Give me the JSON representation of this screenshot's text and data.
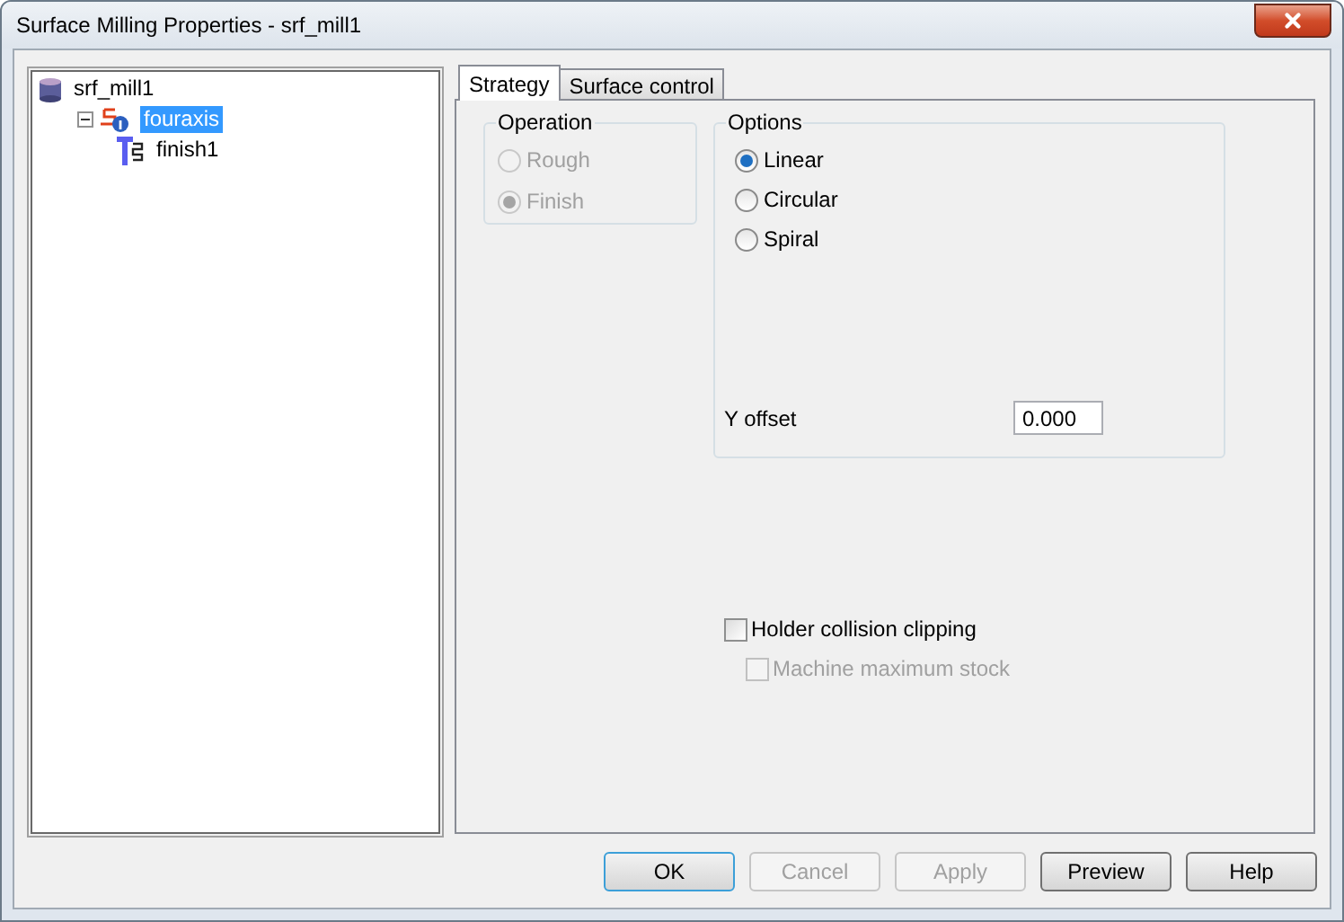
{
  "window": {
    "title": "Surface Milling Properties - srf_mill1"
  },
  "tree": [
    {
      "label": "srf_mill1",
      "kind": "database",
      "selected": false,
      "children": [
        {
          "label": "fouraxis",
          "kind": "operation",
          "selected": true,
          "expanded": true,
          "children": [
            {
              "label": "finish1",
              "kind": "tool",
              "selected": false
            }
          ]
        }
      ]
    }
  ],
  "tabs": [
    {
      "label": "Strategy",
      "selected": true
    },
    {
      "label": "Surface control",
      "selected": false
    }
  ],
  "operation": {
    "title": "Operation",
    "disabled": true,
    "options": [
      {
        "label": "Rough",
        "selected": false
      },
      {
        "label": "Finish",
        "selected": true
      }
    ]
  },
  "options": {
    "title": "Options",
    "choices": [
      {
        "label": "Linear",
        "selected": true
      },
      {
        "label": "Circular",
        "selected": false
      },
      {
        "label": "Spiral",
        "selected": false
      }
    ],
    "y_offset": {
      "label": "Y offset",
      "value": "0.000"
    }
  },
  "checkboxes": [
    {
      "label": "Holder collision clipping",
      "checked": false,
      "disabled": false
    },
    {
      "label": "Machine maximum stock",
      "checked": false,
      "disabled": true
    }
  ],
  "buttons": [
    {
      "label": "OK",
      "disabled": false,
      "default": true
    },
    {
      "label": "Cancel",
      "disabled": true,
      "default": false
    },
    {
      "label": "Apply",
      "disabled": true,
      "default": false
    },
    {
      "label": "Preview",
      "disabled": false,
      "default": false
    },
    {
      "label": "Help",
      "disabled": false,
      "default": false
    }
  ]
}
